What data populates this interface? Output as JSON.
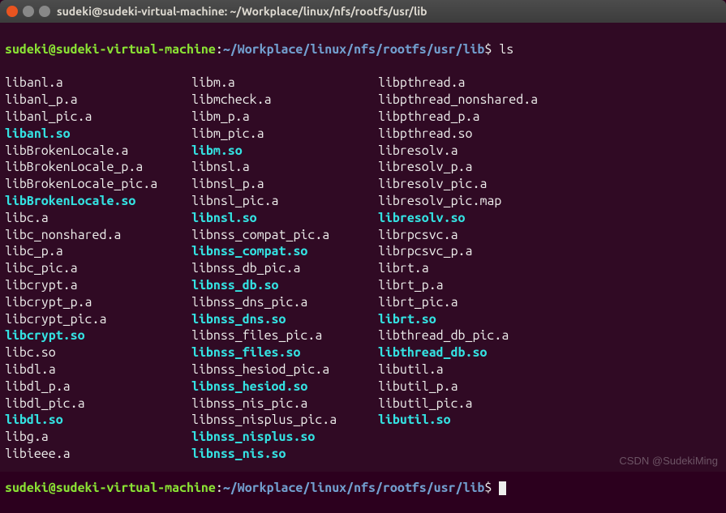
{
  "window": {
    "title": "sudeki@sudeki-virtual-machine: ~/Workplace/linux/nfs/rootfs/usr/lib"
  },
  "prompt": {
    "user_host": "sudeki@sudeki-virtual-machine",
    "colon": ":",
    "path": "~/Workplace/linux/nfs/rootfs/usr/lib",
    "symbol": "$ ",
    "command": "ls"
  },
  "listing": {
    "rows": [
      {
        "c1": {
          "name": "libanl.a",
          "kind": "regular"
        },
        "c2": {
          "name": "libm.a",
          "kind": "regular"
        },
        "c3": {
          "name": "libpthread.a",
          "kind": "regular"
        }
      },
      {
        "c1": {
          "name": "libanl_p.a",
          "kind": "regular"
        },
        "c2": {
          "name": "libmcheck.a",
          "kind": "regular"
        },
        "c3": {
          "name": "libpthread_nonshared.a",
          "kind": "regular"
        }
      },
      {
        "c1": {
          "name": "libanl_pic.a",
          "kind": "regular"
        },
        "c2": {
          "name": "libm_p.a",
          "kind": "regular"
        },
        "c3": {
          "name": "libpthread_p.a",
          "kind": "regular"
        }
      },
      {
        "c1": {
          "name": "libanl.so",
          "kind": "exec"
        },
        "c2": {
          "name": "libm_pic.a",
          "kind": "regular"
        },
        "c3": {
          "name": "libpthread.so",
          "kind": "regular"
        }
      },
      {
        "c1": {
          "name": "libBrokenLocale.a",
          "kind": "regular"
        },
        "c2": {
          "name": "libm.so",
          "kind": "exec"
        },
        "c3": {
          "name": "libresolv.a",
          "kind": "regular"
        }
      },
      {
        "c1": {
          "name": "libBrokenLocale_p.a",
          "kind": "regular"
        },
        "c2": {
          "name": "libnsl.a",
          "kind": "regular"
        },
        "c3": {
          "name": "libresolv_p.a",
          "kind": "regular"
        }
      },
      {
        "c1": {
          "name": "libBrokenLocale_pic.a",
          "kind": "regular"
        },
        "c2": {
          "name": "libnsl_p.a",
          "kind": "regular"
        },
        "c3": {
          "name": "libresolv_pic.a",
          "kind": "regular"
        }
      },
      {
        "c1": {
          "name": "libBrokenLocale.so",
          "kind": "exec"
        },
        "c2": {
          "name": "libnsl_pic.a",
          "kind": "regular"
        },
        "c3": {
          "name": "libresolv_pic.map",
          "kind": "regular"
        }
      },
      {
        "c1": {
          "name": "libc.a",
          "kind": "regular"
        },
        "c2": {
          "name": "libnsl.so",
          "kind": "exec"
        },
        "c3": {
          "name": "libresolv.so",
          "kind": "exec"
        }
      },
      {
        "c1": {
          "name": "libc_nonshared.a",
          "kind": "regular"
        },
        "c2": {
          "name": "libnss_compat_pic.a",
          "kind": "regular"
        },
        "c3": {
          "name": "librpcsvc.a",
          "kind": "regular"
        }
      },
      {
        "c1": {
          "name": "libc_p.a",
          "kind": "regular"
        },
        "c2": {
          "name": "libnss_compat.so",
          "kind": "exec"
        },
        "c3": {
          "name": "librpcsvc_p.a",
          "kind": "regular"
        }
      },
      {
        "c1": {
          "name": "libc_pic.a",
          "kind": "regular"
        },
        "c2": {
          "name": "libnss_db_pic.a",
          "kind": "regular"
        },
        "c3": {
          "name": "librt.a",
          "kind": "regular"
        }
      },
      {
        "c1": {
          "name": "libcrypt.a",
          "kind": "regular"
        },
        "c2": {
          "name": "libnss_db.so",
          "kind": "exec"
        },
        "c3": {
          "name": "librt_p.a",
          "kind": "regular"
        }
      },
      {
        "c1": {
          "name": "libcrypt_p.a",
          "kind": "regular"
        },
        "c2": {
          "name": "libnss_dns_pic.a",
          "kind": "regular"
        },
        "c3": {
          "name": "librt_pic.a",
          "kind": "regular"
        }
      },
      {
        "c1": {
          "name": "libcrypt_pic.a",
          "kind": "regular"
        },
        "c2": {
          "name": "libnss_dns.so",
          "kind": "exec"
        },
        "c3": {
          "name": "librt.so",
          "kind": "exec"
        }
      },
      {
        "c1": {
          "name": "libcrypt.so",
          "kind": "exec"
        },
        "c2": {
          "name": "libnss_files_pic.a",
          "kind": "regular"
        },
        "c3": {
          "name": "libthread_db_pic.a",
          "kind": "regular"
        }
      },
      {
        "c1": {
          "name": "libc.so",
          "kind": "regular"
        },
        "c2": {
          "name": "libnss_files.so",
          "kind": "exec"
        },
        "c3": {
          "name": "libthread_db.so",
          "kind": "exec"
        }
      },
      {
        "c1": {
          "name": "libdl.a",
          "kind": "regular"
        },
        "c2": {
          "name": "libnss_hesiod_pic.a",
          "kind": "regular"
        },
        "c3": {
          "name": "libutil.a",
          "kind": "regular"
        }
      },
      {
        "c1": {
          "name": "libdl_p.a",
          "kind": "regular"
        },
        "c2": {
          "name": "libnss_hesiod.so",
          "kind": "exec"
        },
        "c3": {
          "name": "libutil_p.a",
          "kind": "regular"
        }
      },
      {
        "c1": {
          "name": "libdl_pic.a",
          "kind": "regular"
        },
        "c2": {
          "name": "libnss_nis_pic.a",
          "kind": "regular"
        },
        "c3": {
          "name": "libutil_pic.a",
          "kind": "regular"
        }
      },
      {
        "c1": {
          "name": "libdl.so",
          "kind": "exec"
        },
        "c2": {
          "name": "libnss_nisplus_pic.a",
          "kind": "regular"
        },
        "c3": {
          "name": "libutil.so",
          "kind": "exec"
        }
      },
      {
        "c1": {
          "name": "libg.a",
          "kind": "regular"
        },
        "c2": {
          "name": "libnss_nisplus.so",
          "kind": "exec"
        },
        "c3": {
          "name": "",
          "kind": "regular"
        }
      },
      {
        "c1": {
          "name": "libieee.a",
          "kind": "regular"
        },
        "c2": {
          "name": "libnss_nis.so",
          "kind": "exec"
        },
        "c3": {
          "name": "",
          "kind": "regular"
        }
      }
    ]
  },
  "prompt2": {
    "user_host": "sudeki@sudeki-virtual-machine",
    "colon": ":",
    "path": "~/Workplace/linux/nfs/rootfs/usr/lib",
    "symbol": "$ "
  },
  "watermark": "CSDN @SudekiMing"
}
